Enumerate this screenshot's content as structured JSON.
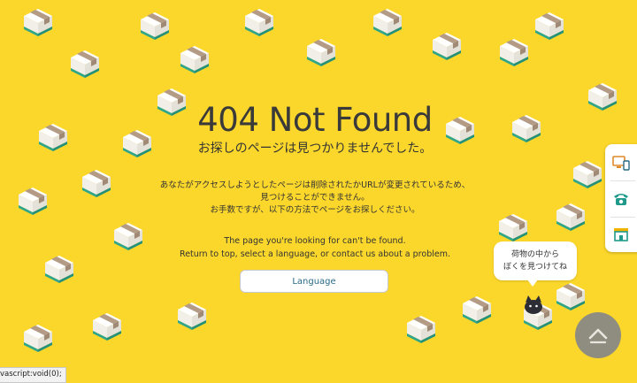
{
  "page": {
    "title": "404 Not Found",
    "subtitle": "お探しのページは見つかりませんでした。",
    "message_jp": [
      "あなたがアクセスしようとしたページは削除されたかURLが変更されているため、",
      "見つけることができません。",
      "お手数ですが、以下の方法でページをお探しください。"
    ],
    "message_en": [
      "The page you're looking for can't be found.",
      "Return to top, select a language, or contact us about a problem."
    ],
    "language_button": "Language"
  },
  "side_nav": {
    "items": [
      {
        "icon": "computer-icon"
      },
      {
        "icon": "phone-icon"
      },
      {
        "icon": "store-icon"
      }
    ]
  },
  "mascot": {
    "bubble_lines": [
      "荷物の中から",
      "ぼくを見つけてね"
    ],
    "icon": "cat-icon"
  },
  "scroll_top": {
    "icon": "arrow-up-icon"
  },
  "status_bar": {
    "text": "vascript:void(0);"
  },
  "colors": {
    "background": "#fbd72b",
    "box_top": "#ffffff",
    "box_tape": "#b39b86",
    "box_base": "#2fa58a",
    "link": "#2a6a86"
  }
}
